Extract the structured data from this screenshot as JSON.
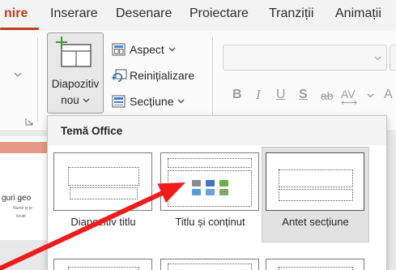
{
  "tabs": [
    {
      "label": "nire",
      "active": true
    },
    {
      "label": "Inserare",
      "active": false
    },
    {
      "label": "Desenare",
      "active": false
    },
    {
      "label": "Proiectare",
      "active": false
    },
    {
      "label": "Tranziții",
      "active": false
    },
    {
      "label": "Animații",
      "active": false
    }
  ],
  "colors": {
    "accent": "#c43e1c",
    "annotation_arrow": "#f01c1c",
    "selected_item_bg": "#e2e2e2"
  },
  "ribbon": {
    "clipboard_group": {
      "expand_icon": "chevron-down-icon",
      "dialog_launcher_icon": "dialog-launcher-icon"
    },
    "slides_group": {
      "new_slide": {
        "label_line1": "Diapozitiv",
        "label_line2": "nou",
        "icon": "new-slide-icon",
        "pressed": true
      },
      "layout": {
        "label": "Aspect",
        "icon": "layout-icon"
      },
      "reset": {
        "label": "Reinițializare",
        "icon": "reset-icon"
      },
      "section": {
        "label": "Secțiune",
        "icon": "section-icon"
      }
    },
    "font_group": {
      "font_name_value": "",
      "disabled": true,
      "bold": "B",
      "italic": "I",
      "underline": "U",
      "shadow": "S",
      "strikethrough": "ab",
      "character_spacing": "AV",
      "change_case": "A"
    }
  },
  "layout_gallery": {
    "header": "Temă Office",
    "layouts": [
      {
        "label": "Diapozitiv titlu",
        "selected": false
      },
      {
        "label": "Titlu și conținut",
        "selected": false
      },
      {
        "label": "Antet secțiune",
        "selected": true
      }
    ]
  },
  "slide_preview": {
    "title_fragment": "guri geo",
    "subtitle_line1": "Nume și pr",
    "subtitle_line2": "locati"
  }
}
